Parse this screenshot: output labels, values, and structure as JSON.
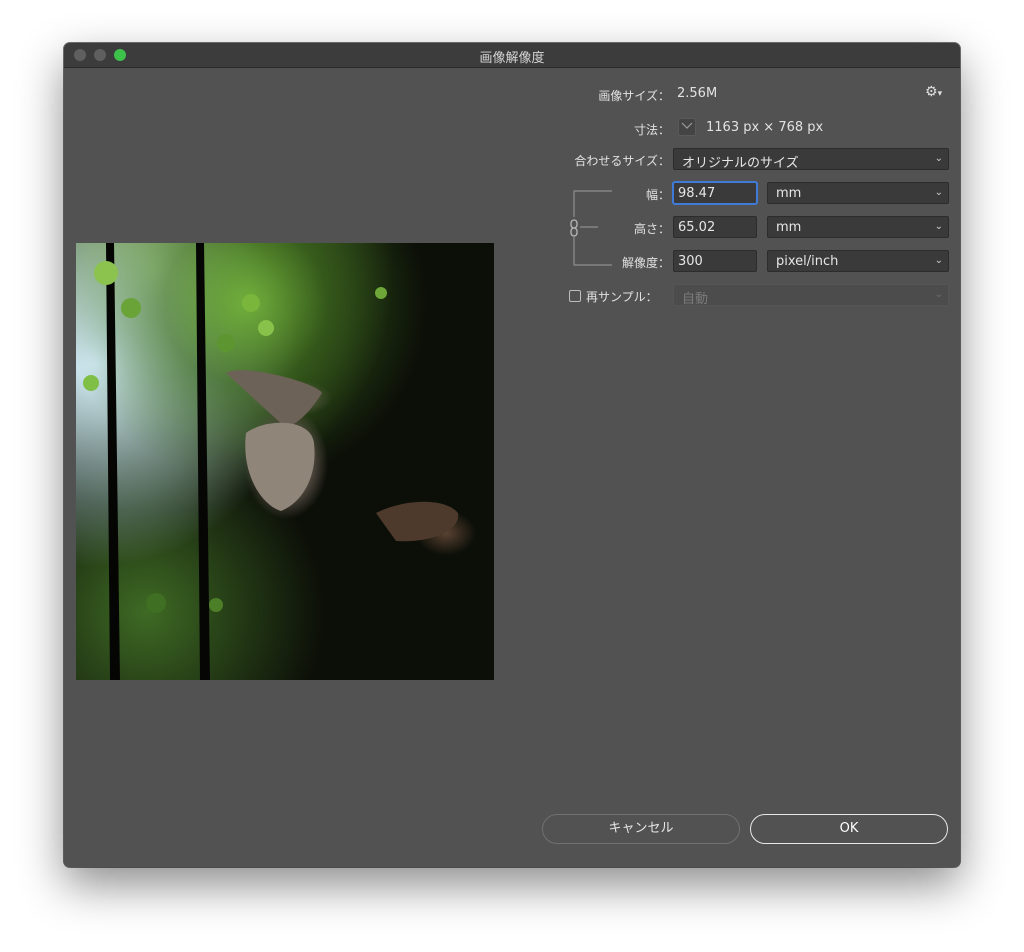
{
  "window": {
    "title": "画像解像度"
  },
  "info": {
    "image_size_label": "画像サイズ：",
    "image_size_value": "2.56M",
    "dimensions_label": "寸法：",
    "dimensions_value": "1163 px × 768 px",
    "dimensions_dropdown_icon": "chevron-down"
  },
  "fit_to": {
    "label": "合わせるサイズ：",
    "value": "オリジナルのサイズ"
  },
  "width": {
    "label": "幅：",
    "value": "98.47",
    "unit": "mm"
  },
  "height": {
    "label": "高さ：",
    "value": "65.02",
    "unit": "mm"
  },
  "resolution": {
    "label": "解像度：",
    "value": "300",
    "unit": "pixel/inch"
  },
  "resample": {
    "label": "再サンプル：",
    "checked": false,
    "value": "自動"
  },
  "buttons": {
    "cancel": "キャンセル",
    "ok": "OK"
  },
  "icons": {
    "settings": "gear-icon",
    "constrain": "chain-link-icon"
  },
  "colors": {
    "background": "#525252",
    "accent_focus": "#3f7bd6",
    "zoom_button": "#3ec14a"
  }
}
